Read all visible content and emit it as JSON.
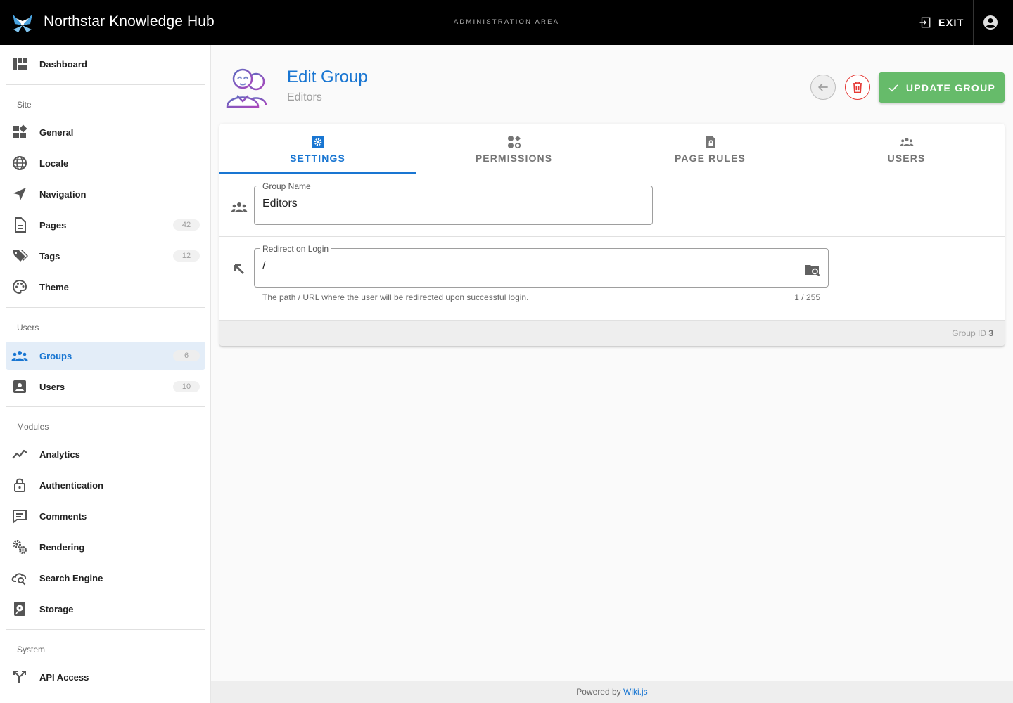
{
  "topbar": {
    "title": "Northstar Knowledge Hub",
    "admin_area": "ADMINISTRATION AREA",
    "exit_label": "EXIT",
    "colors": {
      "background": "#000000",
      "text": "#ffffff"
    }
  },
  "sidebar": {
    "dashboard": {
      "label": "Dashboard",
      "icon": "view-dashboard-icon"
    },
    "site_header": "Site",
    "site_items": [
      {
        "label": "General",
        "icon": "widgets-icon"
      },
      {
        "label": "Locale",
        "icon": "globe-icon"
      },
      {
        "label": "Navigation",
        "icon": "navigation-arrow-icon"
      },
      {
        "label": "Pages",
        "icon": "page-icon",
        "count": "42"
      },
      {
        "label": "Tags",
        "icon": "tags-icon",
        "count": "12"
      },
      {
        "label": "Theme",
        "icon": "palette-icon"
      }
    ],
    "users_header": "Users",
    "users_items": [
      {
        "label": "Groups",
        "icon": "groups-icon",
        "count": "6",
        "active": true
      },
      {
        "label": "Users",
        "icon": "account-box-icon",
        "count": "10"
      }
    ],
    "modules_header": "Modules",
    "modules_items": [
      {
        "label": "Analytics",
        "icon": "chart-line-icon"
      },
      {
        "label": "Authentication",
        "icon": "lock-icon"
      },
      {
        "label": "Comments",
        "icon": "comment-icon"
      },
      {
        "label": "Rendering",
        "icon": "cogs-icon"
      },
      {
        "label": "Search Engine",
        "icon": "cloud-search-icon"
      },
      {
        "label": "Storage",
        "icon": "harddisk-icon"
      }
    ],
    "system_header": "System",
    "system_items": [
      {
        "label": "API Access",
        "icon": "api-icon"
      }
    ],
    "active_color": "#1976d2"
  },
  "header": {
    "title": "Edit Group",
    "subtitle": "Editors",
    "update_label": "UPDATE GROUP",
    "colors": {
      "title": "#1976d2",
      "update_button": "#66bb6a",
      "delete": "#e53935"
    }
  },
  "tabs": [
    {
      "label": "SETTINGS",
      "icon": "settings-box-icon",
      "active": true
    },
    {
      "label": "PERMISSIONS",
      "icon": "permissions-icon"
    },
    {
      "label": "PAGE RULES",
      "icon": "file-lock-icon"
    },
    {
      "label": "USERS",
      "icon": "users-icon"
    }
  ],
  "form": {
    "group_name": {
      "label": "Group Name",
      "value": "Editors"
    },
    "redirect": {
      "label": "Redirect on Login",
      "value": "/",
      "hint": "The path / URL where the user will be redirected upon successful login.",
      "counter": "1 / 255"
    }
  },
  "card_footer": {
    "group_id_label": "Group ID",
    "group_id_value": "3"
  },
  "footer": {
    "prefix": "Powered by",
    "link": "Wiki.js"
  }
}
